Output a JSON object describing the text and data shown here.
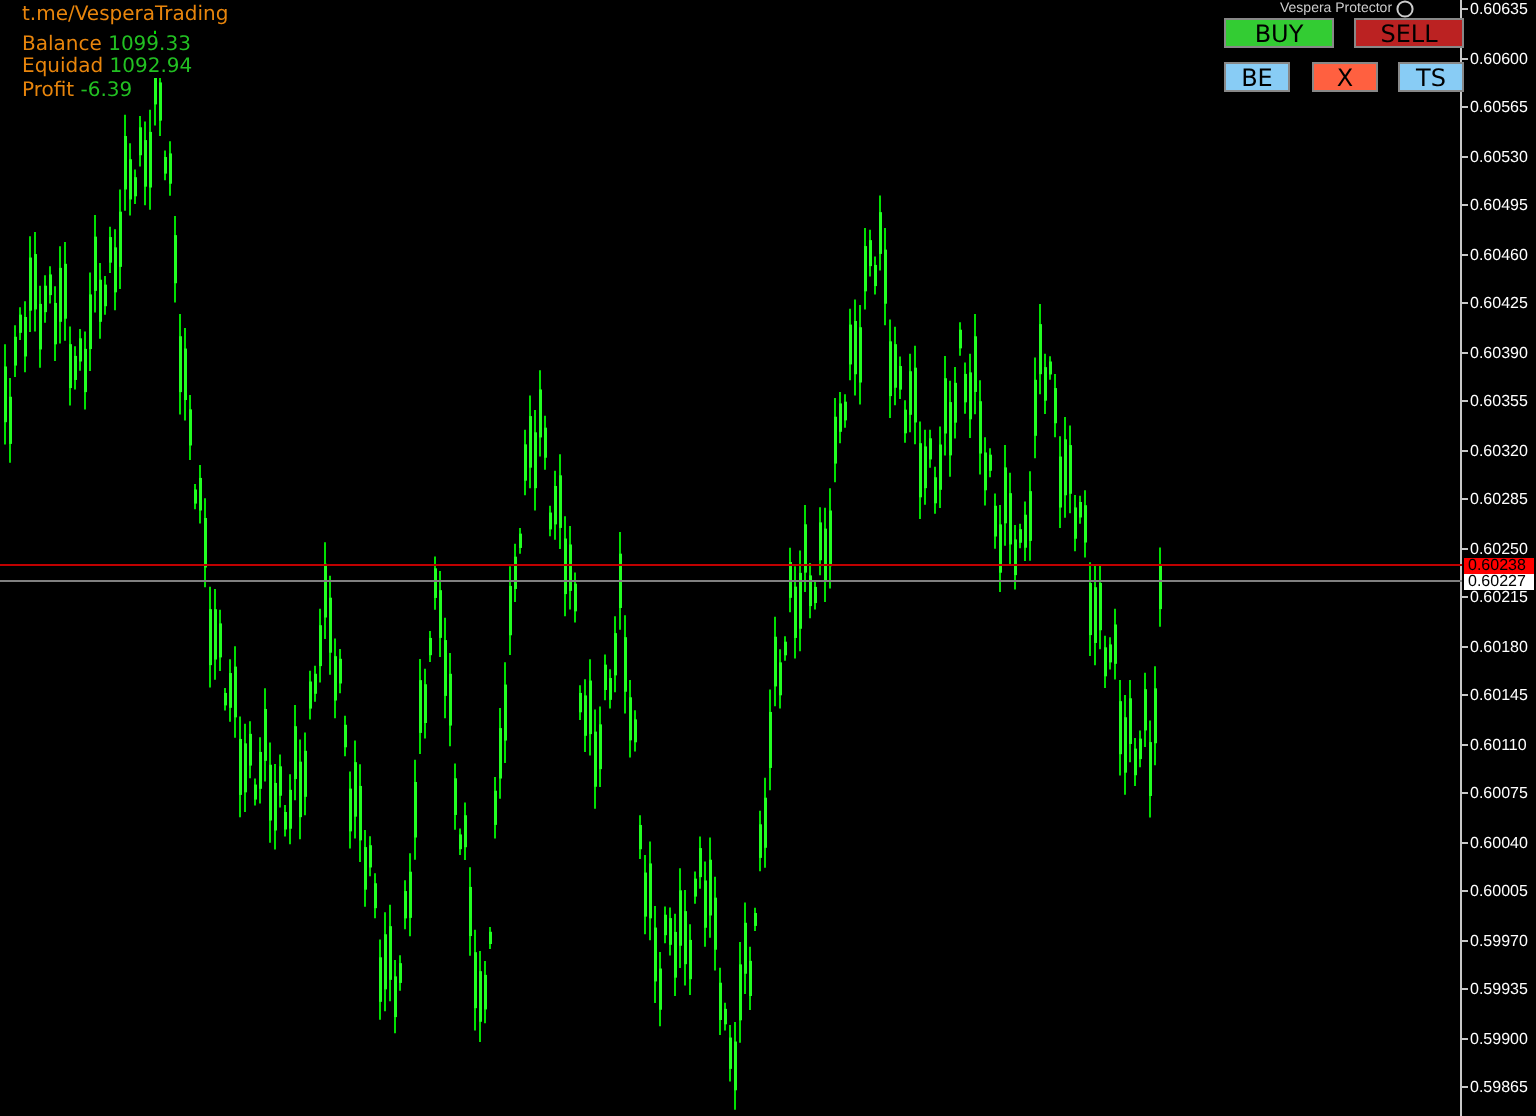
{
  "info_panel": {
    "link": "t.me/VesperaTrading",
    "lines": [
      {
        "label": "Balance",
        "value": "1099.33"
      },
      {
        "label": "Equidad",
        "value": "1092.94"
      },
      {
        "label": "Profit",
        "value": "-6.39"
      }
    ]
  },
  "indicator": {
    "title": "Vespera Protector"
  },
  "buttons": [
    {
      "kind": "buy",
      "label": "BUY"
    },
    {
      "kind": "sell",
      "label": "SELL"
    },
    {
      "kind": "be",
      "label": "BE"
    },
    {
      "kind": "close",
      "label": "X"
    },
    {
      "kind": "ts",
      "label": "TS"
    }
  ],
  "price_axis": {
    "labels": [
      "0.60635",
      "0.60600",
      "0.60565",
      "0.60530",
      "0.60495",
      "0.60460",
      "0.60425",
      "0.60390",
      "0.60355",
      "0.60320",
      "0.60285",
      "0.60250",
      "0.60215",
      "0.60180",
      "0.60145",
      "0.60110",
      "0.60075",
      "0.60040",
      "0.60005",
      "0.59970",
      "0.59935",
      "0.59900",
      "0.59865"
    ]
  },
  "price_lines": [
    {
      "kind": "ask",
      "label": "0.60238"
    },
    {
      "kind": "bid",
      "label": "0.60227"
    }
  ]
}
